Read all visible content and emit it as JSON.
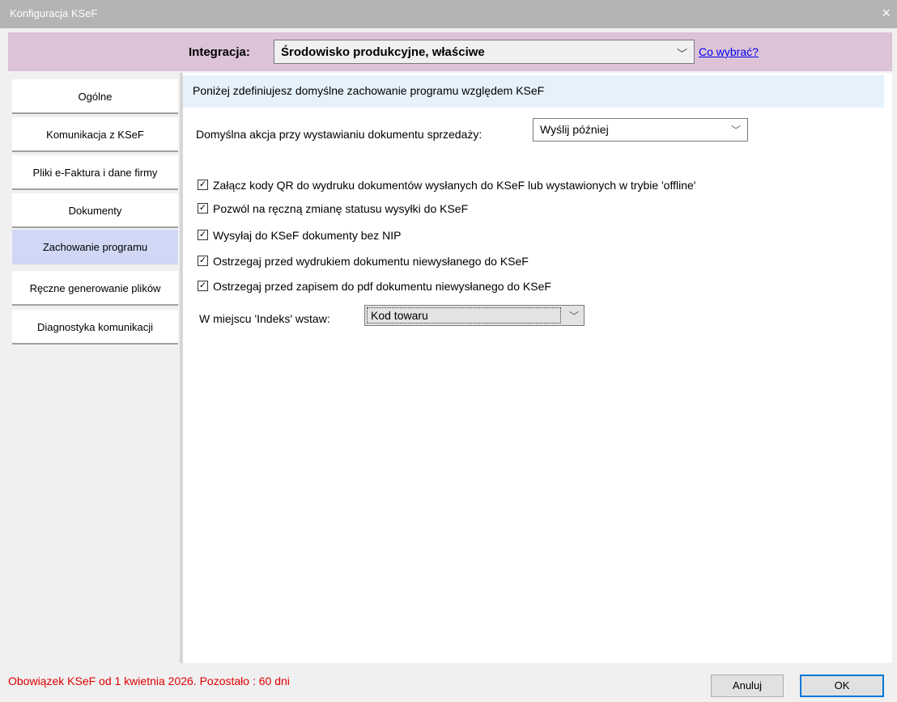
{
  "window": {
    "title": "Konfiguracja KSeF",
    "close_glyph": "×"
  },
  "integration": {
    "label": "Integracja:",
    "value": "Środowisko produkcyjne, właściwe",
    "link": "Co wybrać?"
  },
  "sidebar": {
    "items": [
      {
        "label": "Ogólne"
      },
      {
        "label": "Komunikacja z KSeF"
      },
      {
        "label": "Pliki e-Faktura i dane firmy"
      },
      {
        "label": "Dokumenty"
      },
      {
        "label": "Zachowanie programu",
        "active": true
      },
      {
        "label": "Ręczne generowanie plików"
      },
      {
        "label": "Diagnostyka komunikacji"
      }
    ]
  },
  "content": {
    "info": "Poniżej zdefiniujesz domyślne zachowanie programu względem KSeF",
    "default_action": {
      "label": "Domyślna akcja przy wystawianiu dokumentu sprzedaży:",
      "value": "Wyślij później"
    },
    "checkboxes": [
      {
        "label": "Załącz kody QR do wydruku dokumentów wysłanych do KSeF lub wystawionych w trybie 'offline'",
        "checked": true
      },
      {
        "label": "Pozwól na ręczną zmianę statusu wysyłki do KSeF",
        "checked": true
      },
      {
        "label": "Wysyłaj do KSeF dokumenty bez NIP",
        "checked": true
      },
      {
        "label": "Ostrzegaj przed wydrukiem dokumentu niewysłanego do KSeF",
        "checked": true
      },
      {
        "label": "Ostrzegaj przed zapisem do pdf dokumentu niewysłanego do KSeF",
        "checked": true
      }
    ],
    "index": {
      "label": "W miejscu 'Indeks' wstaw:",
      "value": "Kod towaru"
    }
  },
  "status": {
    "text": "Obowiązek KSeF od 1 kwietnia 2026. Pozostało : 60 dni",
    "color": "#e00000"
  },
  "buttons": {
    "cancel": "Anuluj",
    "ok": "OK"
  },
  "colors": {
    "integration_bar": "#dcc3d8",
    "active_nav": "#d0d8f5",
    "info_bar": "#e5f1fb"
  }
}
